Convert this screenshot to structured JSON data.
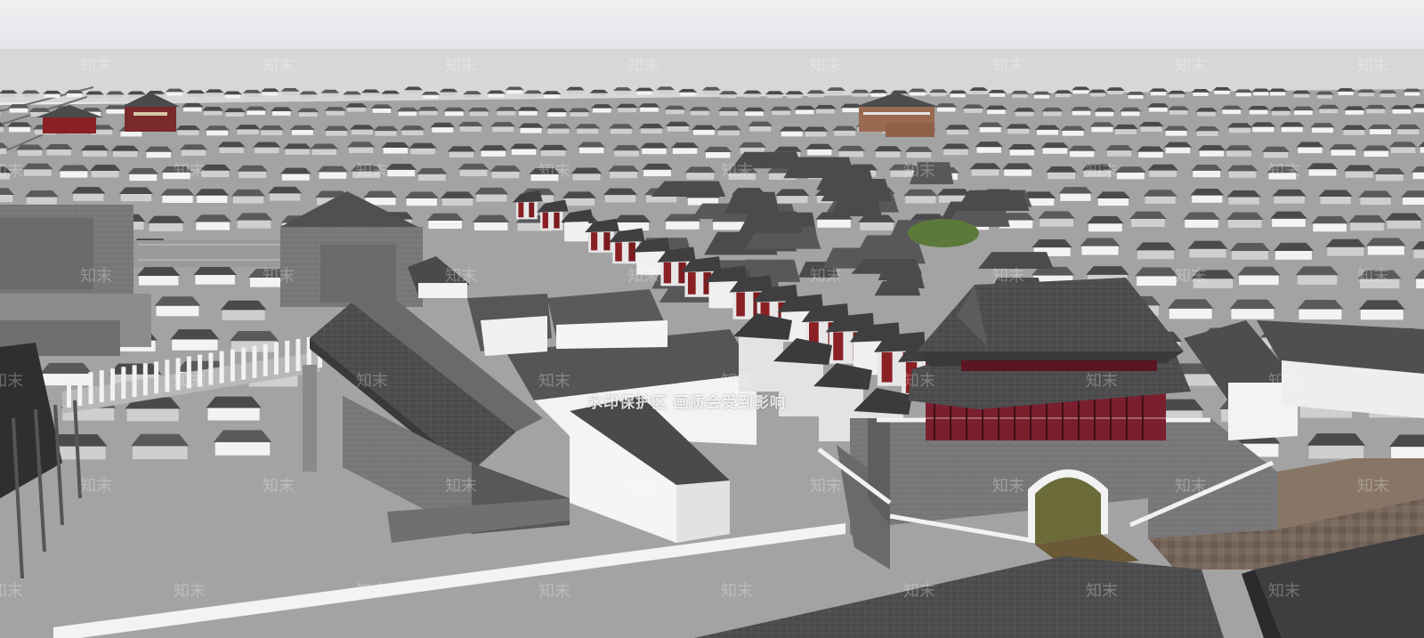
{
  "scene": {
    "description_kind": "3d-model-render",
    "colors": {
      "sky": "#e9ebee",
      "horizon": "#d7d8da",
      "ground": "#9a9a9a",
      "roof_dark": "#4a4a4c",
      "wall_white": "#f2f2f2",
      "brick_grey": "#7b7b7d",
      "accent_red": "#8a1f24",
      "lawn": "#5b7a3a",
      "paving": "#6d5a4c"
    }
  },
  "watermark": {
    "banner": "水印保护区  画质会受到影响",
    "tile_text": "知末"
  }
}
